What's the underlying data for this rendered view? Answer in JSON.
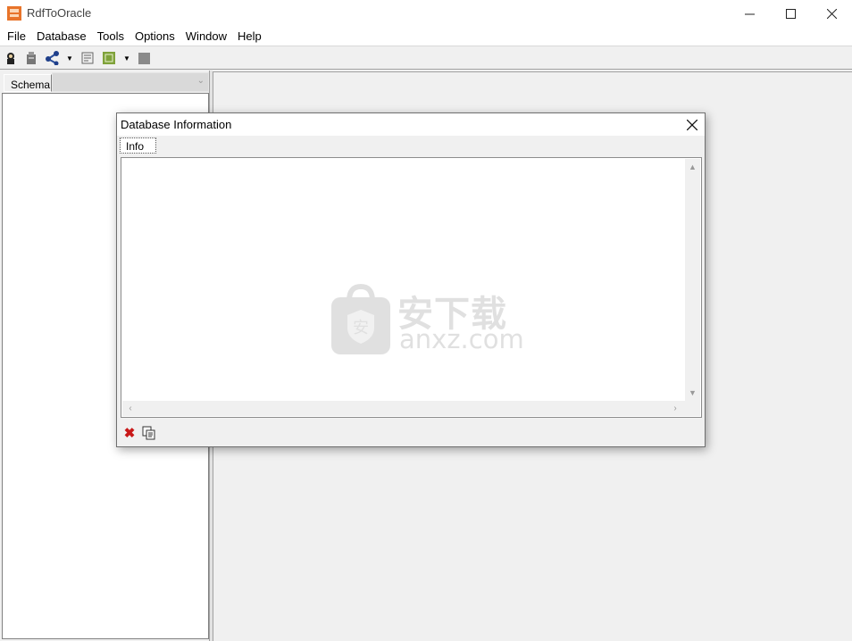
{
  "window": {
    "title": "RdfToOracle"
  },
  "menu": [
    "File",
    "Database",
    "Tools",
    "Options",
    "Window",
    "Help"
  ],
  "toolbar": {
    "icons": [
      "connect-icon",
      "disconnect-icon",
      "schema-network-icon",
      "report-icon",
      "export-icon",
      "stop-icon"
    ]
  },
  "left_panel": {
    "tab_label": "Schema",
    "combo_value": ""
  },
  "dialog": {
    "title": "Database Information",
    "tab_label": "Info",
    "content": "",
    "buttons": [
      "clear-icon",
      "copy-icon"
    ]
  },
  "watermark": {
    "cn": "安下载",
    "en": "anxz.com",
    "badge": "安"
  },
  "colors": {
    "accent": "#e8742a",
    "clear_red": "#c81818",
    "watermark": "#c8c8c8"
  }
}
